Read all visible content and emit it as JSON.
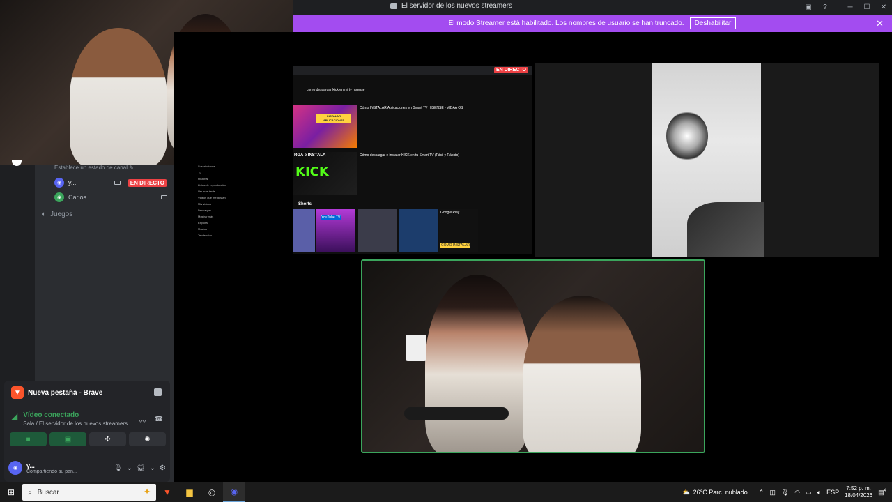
{
  "window": {
    "title": "El servidor de los nuevos streamers"
  },
  "banner": {
    "message": "El modo Streamer está habilitado. Los nombres de usuario se han truncado.",
    "disable_label": "Deshabilitar"
  },
  "sidebar": {
    "status_hint": "Establece un estado de canal ✎",
    "voice_users": [
      {
        "name": "y...",
        "badge": "EN DIRECTO"
      },
      {
        "name": "Carlos"
      }
    ],
    "channel": "Juegos"
  },
  "popup": {
    "title": "Nueva pestaña - Brave",
    "status": "Vídeo conectado",
    "location": "Sala / El servidor de los nuevos streamers",
    "user": {
      "name": "y...",
      "activity": "Compartiendo su pan..."
    }
  },
  "stage": {
    "live_tag": "EN DIRECTO",
    "share": {
      "search_text": "como descargar kick en mi tv hisense",
      "video1_title": "Cómo INSTALAR Aplicaciones en Smart TV HISENSE - VIDAA OS",
      "video2_title": "Cómo descargar e instalar KICK en tu Smart TV (Fácil y Rápido)",
      "thumb1_label": "INSTALAR APLICACIONES",
      "thumb2_big": "KICK",
      "thumb2_top": "RGA e INSTALA",
      "shorts_label": "Shorts",
      "short_text1": "YouTube TV",
      "short_text2": "COMO INSTALAR",
      "google_play": "Google Play",
      "menu_items": [
        "Suscripciones",
        "Tú",
        "Historial",
        "Listas de reproducción",
        "Ver más tarde",
        "Videos que me gustan",
        "Mis videos",
        "Descargas",
        "Mostrar más",
        "Explorar",
        "Música",
        "Tendencias"
      ]
    }
  },
  "taskbar": {
    "search_placeholder": "Buscar",
    "weather": "26°C  Parc. nublado",
    "lang": "ESP",
    "time": "7:52 p. m.",
    "date": "18/04/2026",
    "notif_count": "4"
  },
  "colors": {
    "banner": "#a34cf0",
    "live": "#ed4245",
    "connected": "#3ba55c",
    "sidebar": "#2b2d31"
  }
}
